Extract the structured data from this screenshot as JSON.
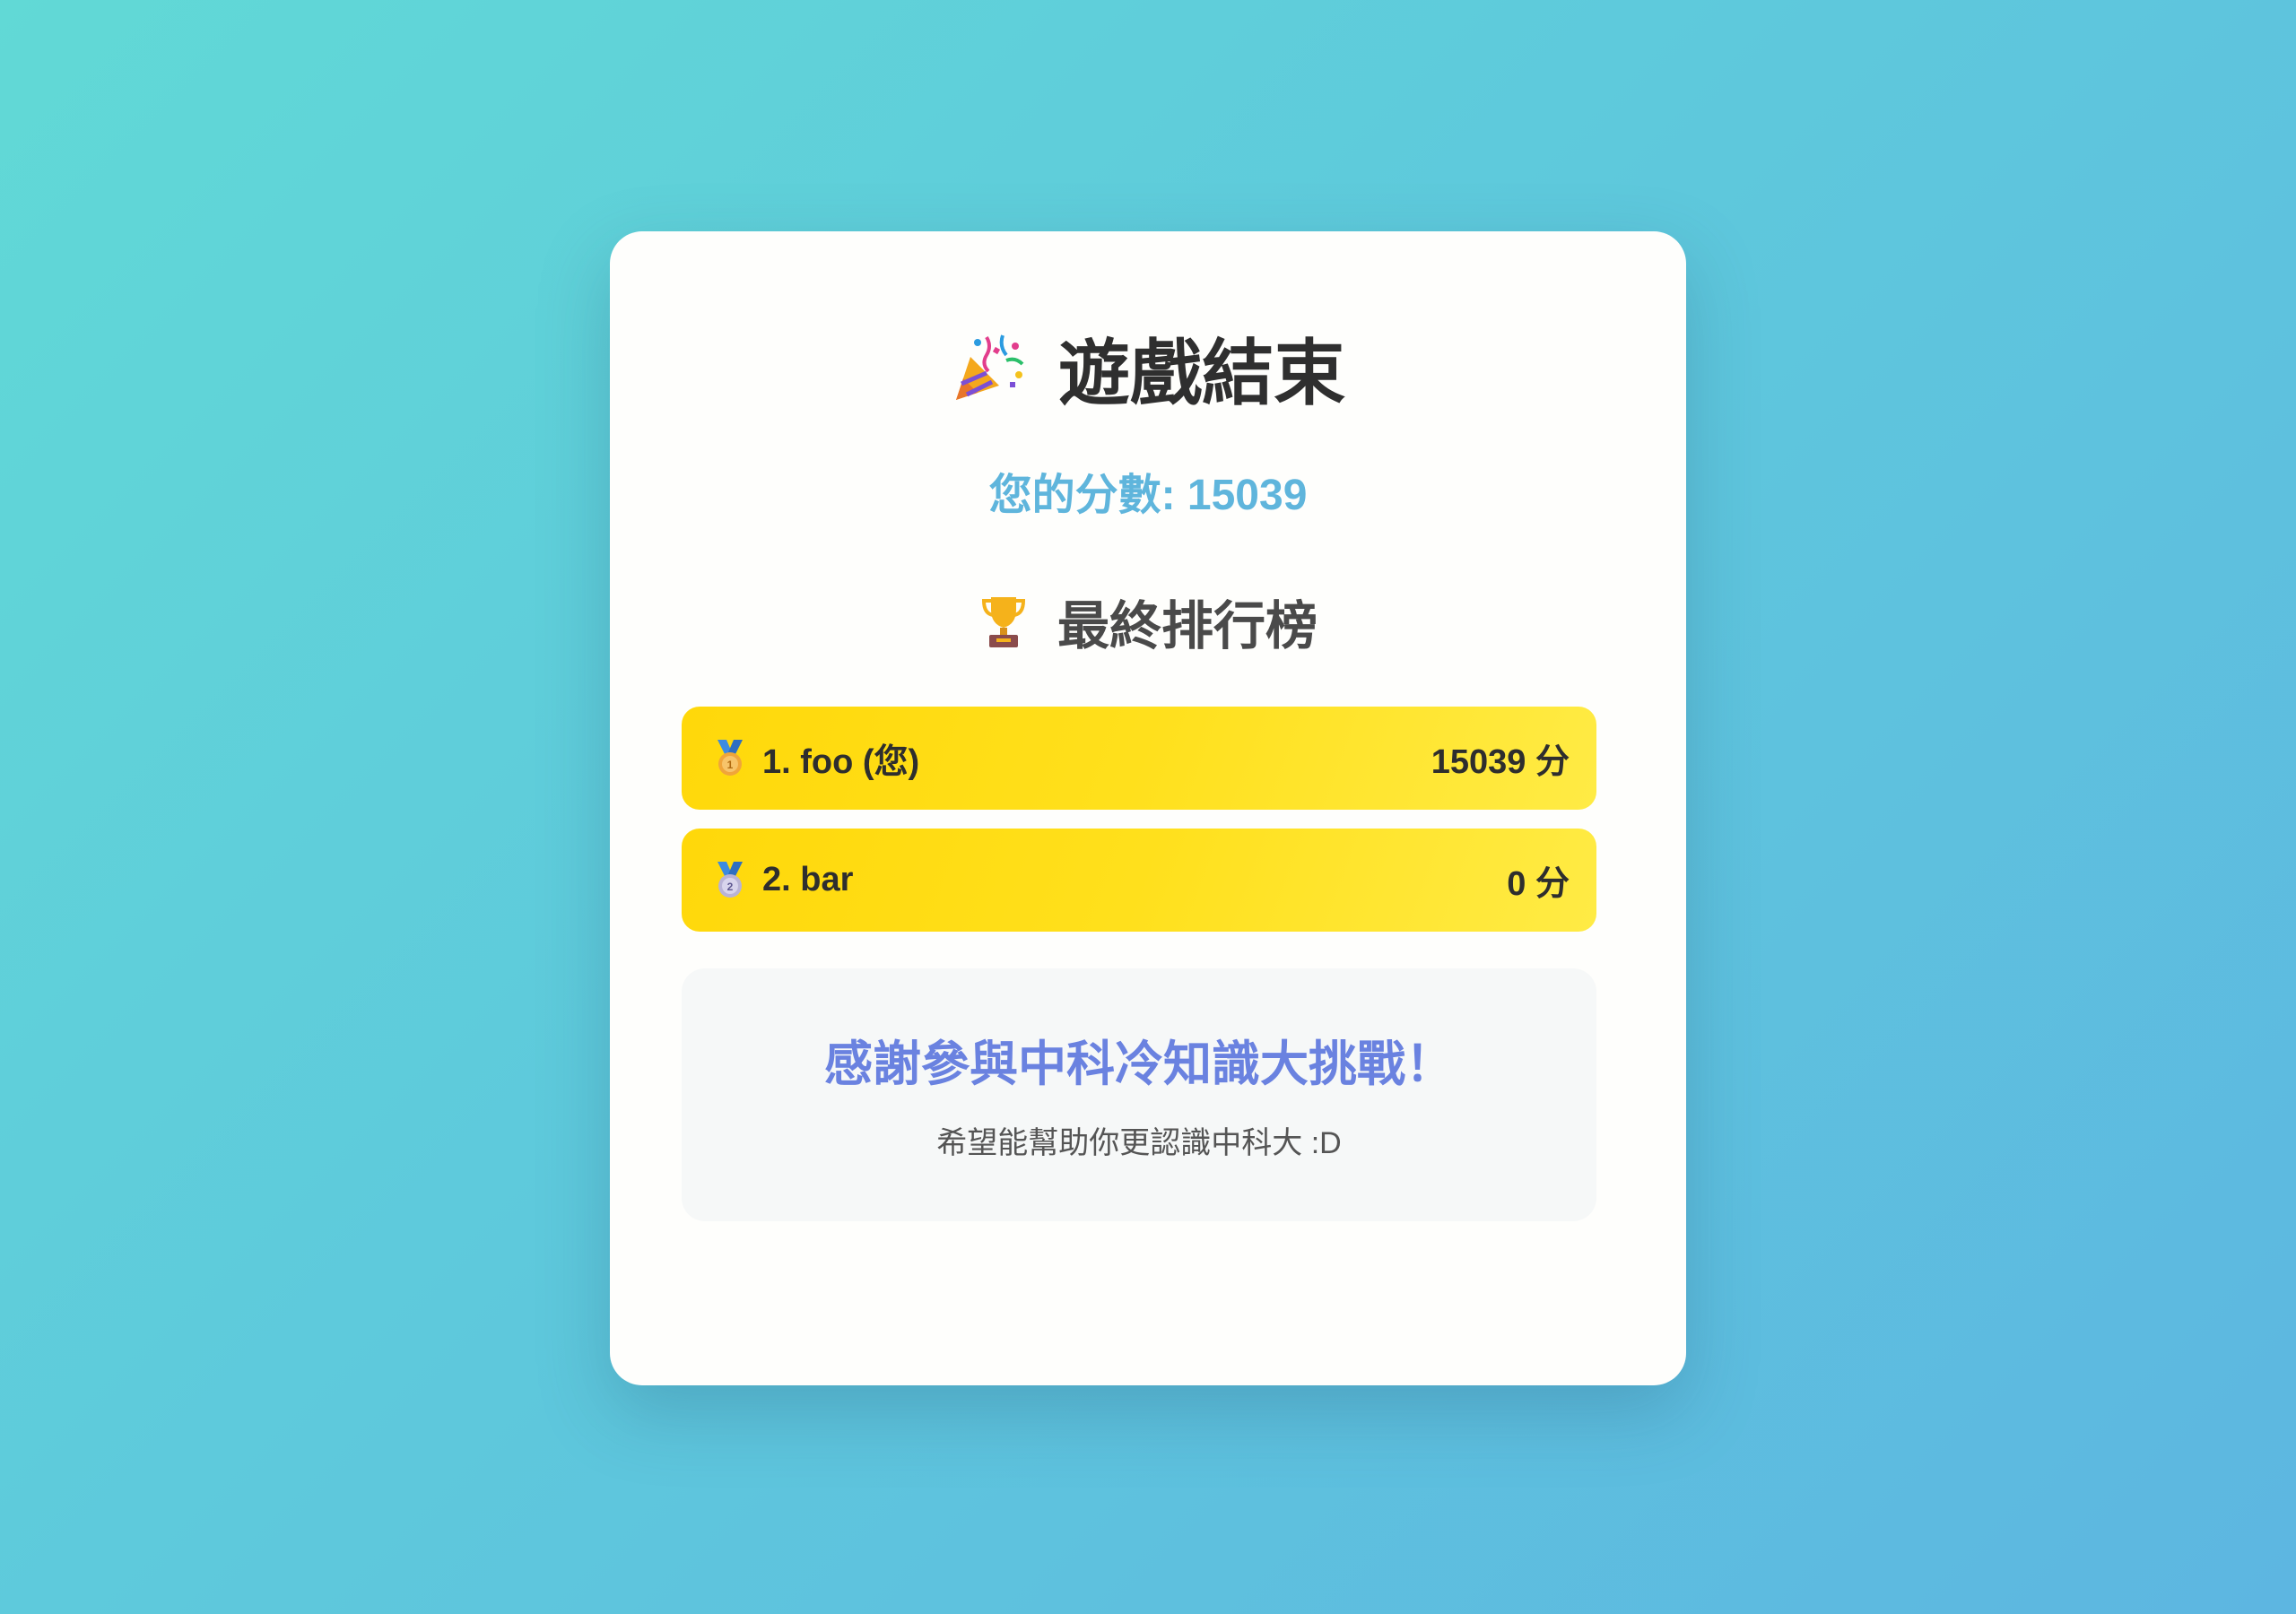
{
  "header": {
    "title": "遊戲結束",
    "title_icon": "party-popper-icon"
  },
  "score": {
    "text": "您的分數: 15039"
  },
  "leaderboard": {
    "title": "最終排行榜",
    "title_icon": "trophy-icon",
    "entries": [
      {
        "medal_icon": "gold-medal-icon",
        "name": "1. foo (您)",
        "score": "15039 分"
      },
      {
        "medal_icon": "silver-medal-icon",
        "name": "2. bar",
        "score": "0 分"
      }
    ]
  },
  "thanks": {
    "title": "感謝參與中科冷知識大挑戰！",
    "subtitle": "希望能幫助你更認識中科大 :D"
  },
  "colors": {
    "background_start": "#61d9d6",
    "background_end": "#5db6e1",
    "score": "#5fb5dc",
    "row_gold": "#ffd80a",
    "thanks_title": "#6a82e0"
  }
}
